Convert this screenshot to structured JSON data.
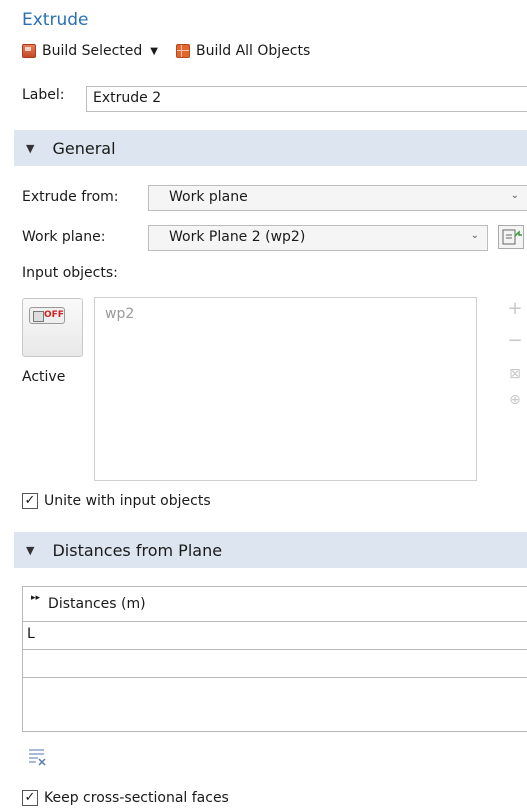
{
  "title": "Extrude",
  "toolbar": {
    "build_selected": "Build Selected",
    "build_all": "Build All Objects"
  },
  "label": {
    "caption": "Label:",
    "value": "Extrude 2"
  },
  "sections": {
    "general": "General",
    "distances": "Distances from Plane"
  },
  "general": {
    "extrude_from_label": "Extrude from:",
    "extrude_from_value": "Work plane",
    "work_plane_label": "Work plane:",
    "work_plane_value": "Work Plane 2 (wp2)",
    "input_objects_label": "Input objects:",
    "active_toggle_text": "OFF",
    "active_label": "Active",
    "input_objects": [
      "wp2"
    ],
    "unite_label": "Unite with input objects",
    "unite_checked": true
  },
  "distances": {
    "column_header": "Distances (m)",
    "rows": [
      "L",
      ""
    ],
    "keep_faces_label": "Keep cross-sectional faces",
    "keep_faces_checked": true
  },
  "colors": {
    "accent": "#2a6fb5",
    "section_bg": "#dde6f0"
  }
}
